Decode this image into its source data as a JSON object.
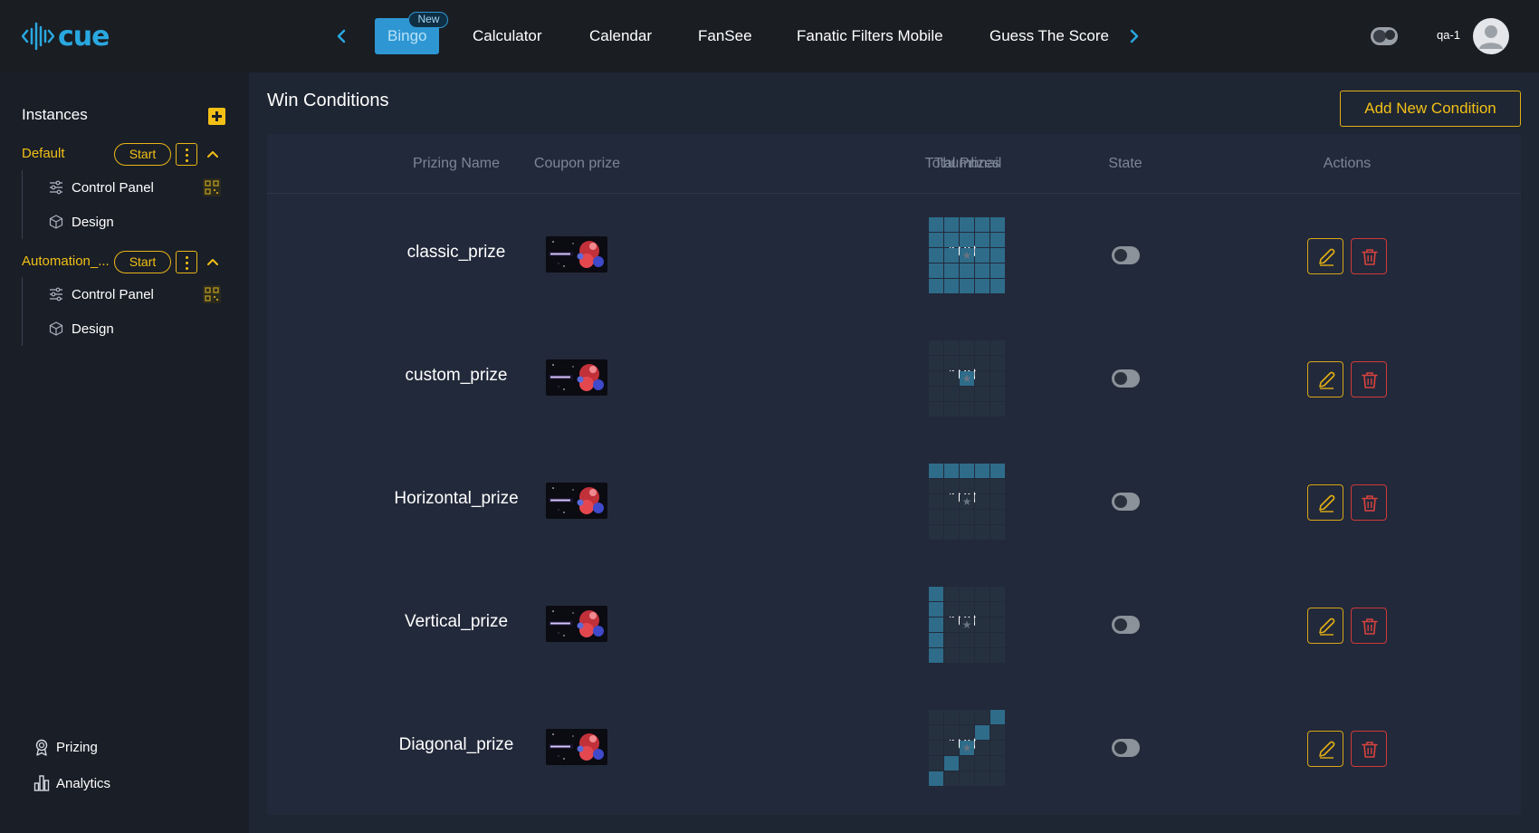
{
  "app": {
    "logo_text": "cue",
    "brand_color": "#29a8e0",
    "accent_color": "#f2c016"
  },
  "header": {
    "tabs": [
      {
        "label": "Bingo",
        "badge": "New",
        "active": true
      },
      {
        "label": "Calculator",
        "active": false
      },
      {
        "label": "Calendar",
        "active": false
      },
      {
        "label": "FanSee",
        "active": false
      },
      {
        "label": "Fanatic Filters Mobile",
        "active": false
      },
      {
        "label": "Guess The Score",
        "active": false
      }
    ],
    "user_name": "qa-1"
  },
  "sidebar": {
    "heading": "Instances",
    "instances": [
      {
        "name": "Default",
        "start_label": "Start",
        "items": [
          {
            "label": "Control Panel",
            "icon": "sliders-icon"
          },
          {
            "label": "Design",
            "icon": "cube-icon"
          }
        ]
      },
      {
        "name": "Automation_...",
        "start_label": "Start",
        "items": [
          {
            "label": "Control Panel",
            "icon": "sliders-icon"
          },
          {
            "label": "Design",
            "icon": "cube-icon"
          }
        ]
      }
    ],
    "bottom": [
      {
        "label": "Prizing",
        "icon": "award-icon"
      },
      {
        "label": "Analytics",
        "icon": "bar-chart-icon"
      }
    ]
  },
  "main": {
    "title": "Win Conditions",
    "add_button": "Add New Condition",
    "columns": [
      "Prizing Name",
      "Coupon prize",
      "Total Prizes",
      "Thumbnail",
      "State",
      "Actions"
    ],
    "rows": [
      {
        "name": "classic_prize",
        "total": "100",
        "pattern": "all",
        "state": "off"
      },
      {
        "name": "custom_prize",
        "total": "100",
        "pattern": "center",
        "state": "off"
      },
      {
        "name": "Horizontal_prize",
        "total": "100",
        "pattern": "top-row",
        "state": "off"
      },
      {
        "name": "Vertical_prize",
        "total": "100",
        "pattern": "left-column",
        "state": "off"
      },
      {
        "name": "Diagonal_prize",
        "total": "100",
        "pattern": "diagonal",
        "state": "off"
      }
    ]
  }
}
